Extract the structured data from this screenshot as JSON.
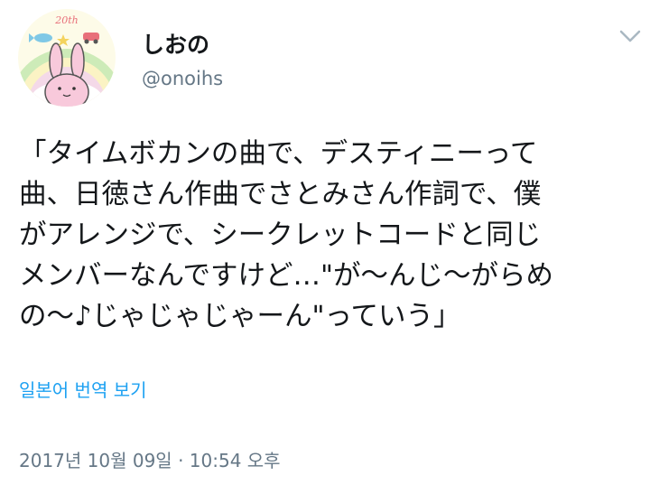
{
  "user": {
    "display_name": "しおの",
    "handle": "@onoihs",
    "avatar_badge": "20th"
  },
  "header": {
    "menu_icon": "chevron-down-icon"
  },
  "tweet": {
    "text": "「タイムボカンの曲で、デスティニーって\n曲、日徳さん作曲でさとみさん作詞で、僕\nがアレンジで、シークレットコードと同じ\nメンバーなんですけど…\"が〜んじ〜がらめ\nの〜♪じゃじゃじゃーん\"っていう」",
    "translate_label": "일본어 번역 보기",
    "timestamp": "2017년 10월 09일 · 10:54 오후"
  },
  "colors": {
    "link": "#1da1f2",
    "secondary_text": "#657786",
    "primary_text": "#14171a"
  }
}
